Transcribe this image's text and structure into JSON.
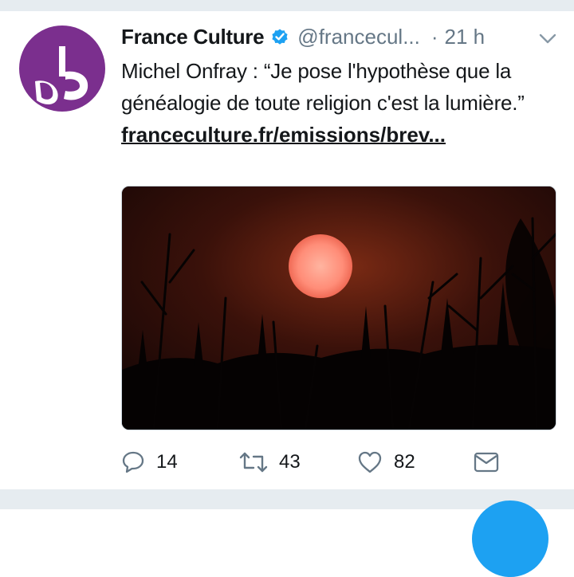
{
  "tweet": {
    "author_name": "France Culture",
    "handle": "@francecul...",
    "separator": "·",
    "time": "21 h",
    "text_prefix": "Michel Onfray : “Je pose l'hypothèse que la généalogie de toute religion c'est la lumière.”",
    "link_text": "franceculture.fr/emissions/brev...",
    "image_description": "sunset",
    "image_icon": "red-sun-through-trees"
  },
  "actions": {
    "reply_count": "14",
    "retweet_count": "43",
    "like_count": "82"
  },
  "icons": {
    "verified": "verified-badge-icon",
    "menu": "chevron-down-icon",
    "reply": "reply-icon",
    "retweet": "retweet-icon",
    "like": "heart-icon",
    "dm": "envelope-icon"
  },
  "colors": {
    "avatar_bg": "#7b2f8e",
    "verified": "#1da1f2",
    "secondary_text": "#657786",
    "icon": "#657786",
    "divider": "#e6ecf0"
  }
}
